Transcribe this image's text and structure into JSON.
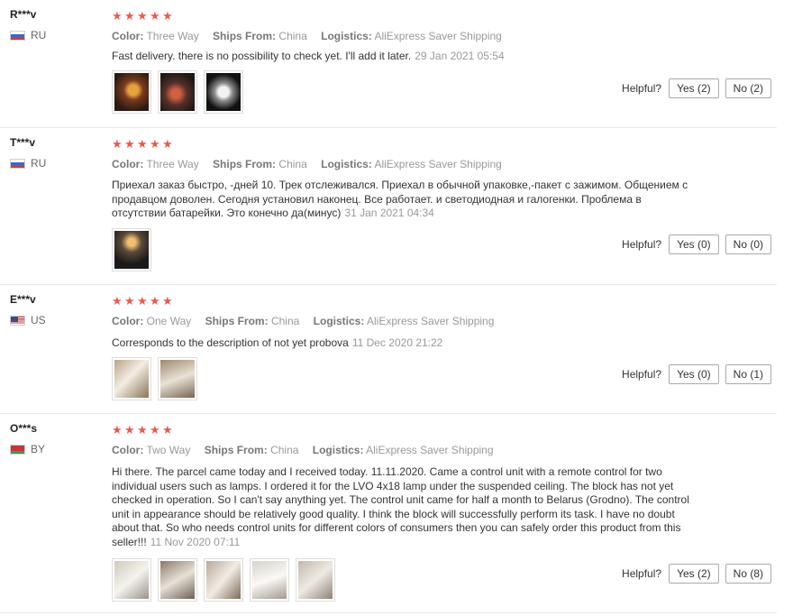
{
  "labels": {
    "color": "Color:",
    "ships_from": "Ships From:",
    "logistics": "Logistics:",
    "helpful": "Helpful?"
  },
  "star_color": "#e85a4f",
  "reviews": [
    {
      "user": "R***v",
      "country": "RU",
      "flag": "flag-ru-icon",
      "rating": 5,
      "color": "Three Way",
      "ships_from": "China",
      "logistics": "AliExpress Saver Shipping",
      "text": "Fast delivery. there is no possibility to check yet. I'll add it later.",
      "date": "29 Jan 2021 05:54",
      "photos": [
        "review-photo",
        "review-photo",
        "review-photo"
      ],
      "yes": "Yes (2)",
      "no": "No (2)"
    },
    {
      "user": "T***v",
      "country": "RU",
      "flag": "flag-ru-icon",
      "rating": 5,
      "color": "Three Way",
      "ships_from": "China",
      "logistics": "AliExpress Saver Shipping",
      "text": "Приехал заказ быстро, -дней 10. Трек отслеживался. Приехал в обычной упаковке,-пакет с зажимом. Общением с продавцом доволен. Сегодня установил наконец. Все работает. и светодиодная и галогенки. Проблема в отсутствии батарейки. Это конечно да(минус)",
      "date": "31 Jan 2021 04:34",
      "photos": [
        "review-photo"
      ],
      "yes": "Yes (0)",
      "no": "No (0)"
    },
    {
      "user": "E***v",
      "country": "US",
      "flag": "flag-us-icon",
      "rating": 5,
      "color": "One Way",
      "ships_from": "China",
      "logistics": "AliExpress Saver Shipping",
      "text": "Corresponds to the description of not yet probova",
      "date": "11 Dec 2020 21:22",
      "photos": [
        "review-photo",
        "review-photo"
      ],
      "yes": "Yes (0)",
      "no": "No (1)"
    },
    {
      "user": "O***s",
      "country": "BY",
      "flag": "flag-by-icon",
      "rating": 5,
      "color": "Two Way",
      "ships_from": "China",
      "logistics": "AliExpress Saver Shipping",
      "text": "Hi there. The parcel came today and I received today. 11.11.2020. Came a control unit with a remote control for two individual users such as lamps. I ordered it for the LVO 4x18 lamp under the suspended ceiling. The block has not yet checked in operation. So I can't say anything yet. The control unit came for half a month to Belarus (Grodno). The control unit in appearance should be relatively good quality. I think the block will successfully perform its task. I have no doubt about that. So who needs control units for different colors of consumers then you can safely order this product from this seller!!!",
      "date": "11 Nov 2020 07:11",
      "photos": [
        "review-photo",
        "review-photo",
        "review-photo",
        "review-photo",
        "review-photo"
      ],
      "yes": "Yes (2)",
      "no": "No (8)"
    }
  ]
}
